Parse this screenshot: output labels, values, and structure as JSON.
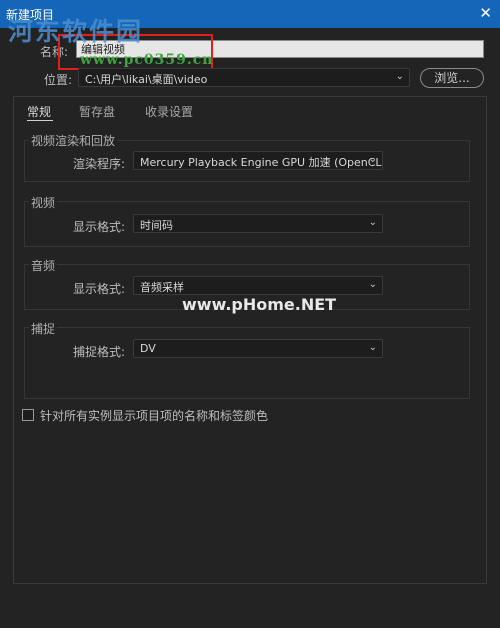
{
  "window": {
    "title": "新建项目",
    "close_label": "✕"
  },
  "watermarks": {
    "site_cn": "河东软件园",
    "site_url": "www.pc0359.cn",
    "phome": "www.pHome.NET"
  },
  "name_field": {
    "label": "名称:",
    "value": "编辑视频"
  },
  "location": {
    "label": "位置:",
    "value": "C:\\用户\\likai\\桌面\\video",
    "browse_label": "浏览..."
  },
  "tabs": [
    {
      "label": "常规",
      "active": true
    },
    {
      "label": "暂存盘",
      "active": false
    },
    {
      "label": "收录设置",
      "active": false
    }
  ],
  "sections": {
    "playback": {
      "title": "视频渲染和回放",
      "field_label": "渲染程序:",
      "value": "Mercury Playback Engine GPU 加速 (OpenCL)"
    },
    "video": {
      "title": "视频",
      "field_label": "显示格式:",
      "value": "时间码"
    },
    "audio": {
      "title": "音频",
      "field_label": "显示格式:",
      "value": "音频采样"
    },
    "capture": {
      "title": "捕捉",
      "field_label": "捕捉格式:",
      "value": "DV"
    }
  },
  "checkbox": {
    "label": "针对所有实例显示项目项的名称和标签颜色",
    "checked": false
  },
  "colors": {
    "titlebar": "#1565b8",
    "background": "#232323",
    "highlight": "#e0201d"
  }
}
